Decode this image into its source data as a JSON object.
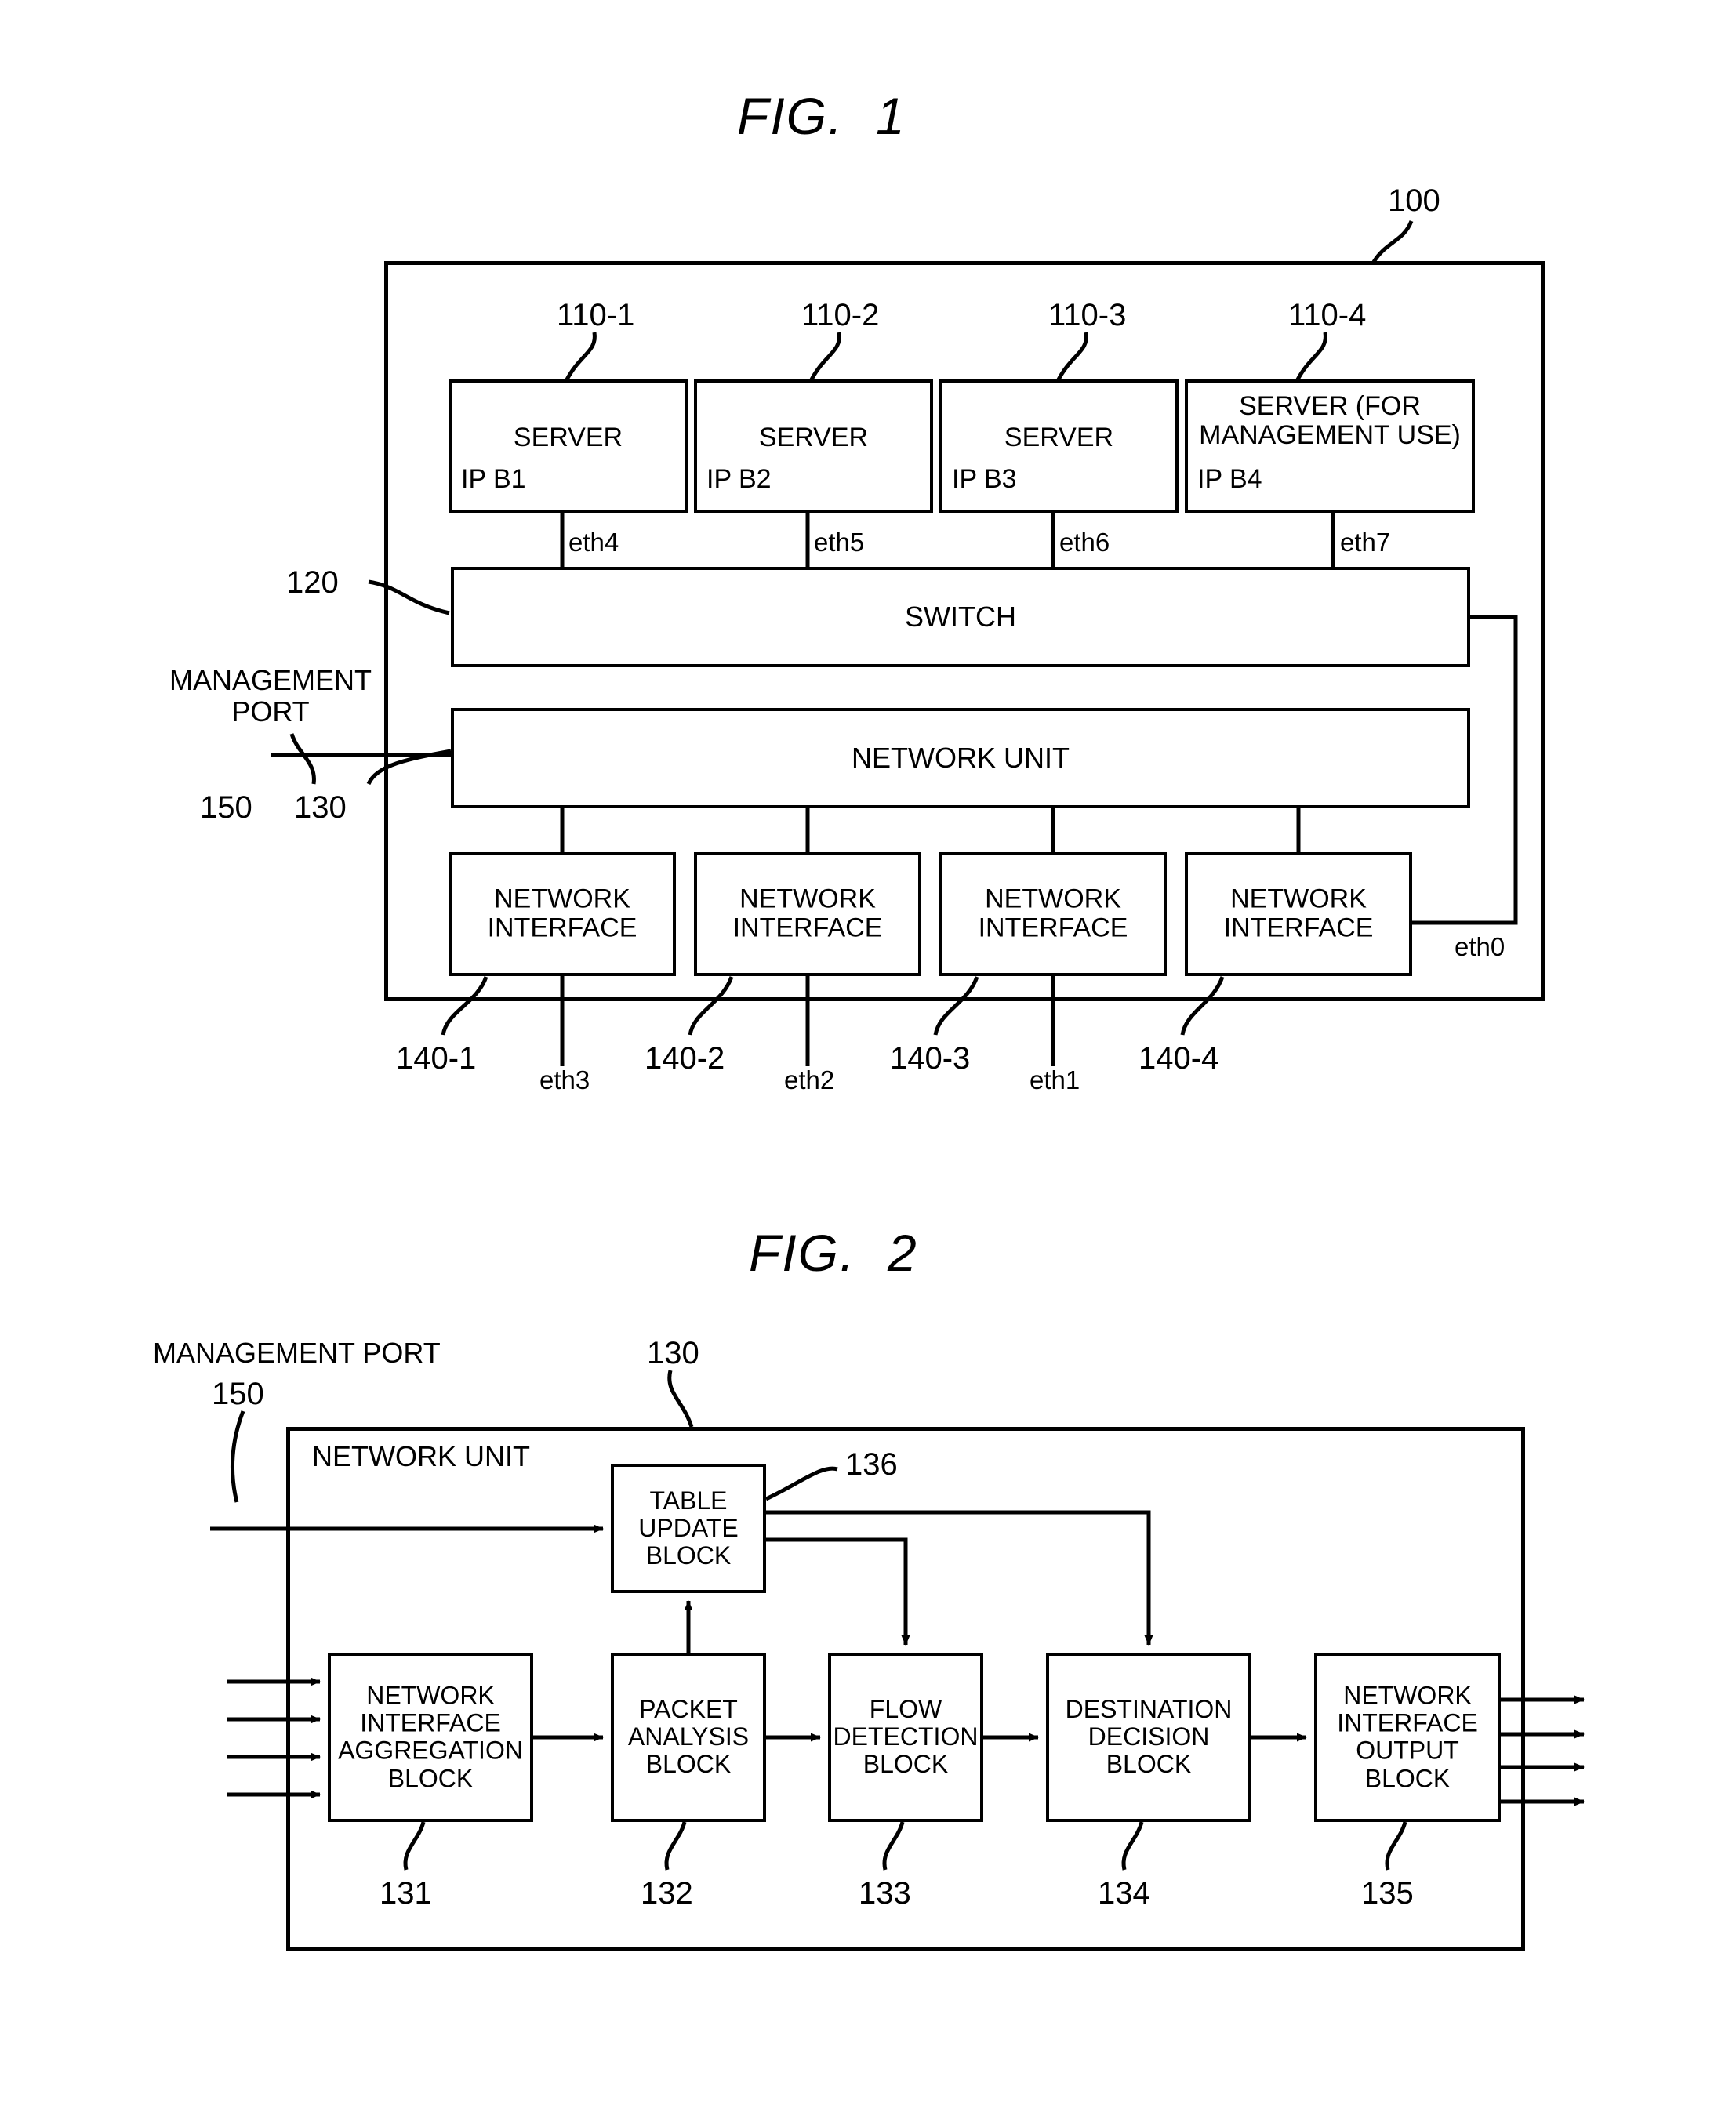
{
  "figures": [
    {
      "title": "FIG.  1",
      "outer_ref": "100",
      "servers": [
        {
          "ref": "110-1",
          "name": "SERVER",
          "ip": "IP B1",
          "port": "eth4"
        },
        {
          "ref": "110-2",
          "name": "SERVER",
          "ip": "IP B2",
          "port": "eth5"
        },
        {
          "ref": "110-3",
          "name": "SERVER",
          "ip": "IP B3",
          "port": "eth6"
        },
        {
          "ref": "110-4",
          "name": "SERVER (FOR\nMANAGEMENT USE)",
          "ip": "IP B4",
          "port": "eth7"
        }
      ],
      "switch": {
        "ref": "120",
        "label": "SWITCH"
      },
      "network_unit": {
        "ref": "130",
        "label": "NETWORK UNIT"
      },
      "management_port": {
        "ref": "150",
        "label": "MANAGEMENT\nPORT"
      },
      "interfaces": [
        {
          "ref": "140-1",
          "label": "NETWORK\nINTERFACE",
          "port": "eth3"
        },
        {
          "ref": "140-2",
          "label": "NETWORK\nINTERFACE",
          "port": "eth2"
        },
        {
          "ref": "140-3",
          "label": "NETWORK\nINTERFACE",
          "port": "eth1"
        },
        {
          "ref": "140-4",
          "label": "NETWORK\nINTERFACE",
          "port": ""
        }
      ],
      "switch_uplink_port": "eth0"
    },
    {
      "title": "FIG.  2",
      "outer_ref": "130",
      "outer_label": "NETWORK UNIT",
      "management_port": {
        "ref": "150",
        "label": "MANAGEMENT PORT"
      },
      "table_update": {
        "ref": "136",
        "label": "TABLE\nUPDATE\nBLOCK"
      },
      "blocks": [
        {
          "ref": "131",
          "label": "NETWORK\nINTERFACE\nAGGREGATION\nBLOCK"
        },
        {
          "ref": "132",
          "label": "PACKET\nANALYSIS\nBLOCK"
        },
        {
          "ref": "133",
          "label": "FLOW\nDETECTION\nBLOCK"
        },
        {
          "ref": "134",
          "label": "DESTINATION\nDECISION\nBLOCK"
        },
        {
          "ref": "135",
          "label": "NETWORK\nINTERFACE\nOUTPUT\nBLOCK"
        }
      ]
    }
  ],
  "colors": {
    "ink": "#000000",
    "paper": "#ffffff"
  }
}
